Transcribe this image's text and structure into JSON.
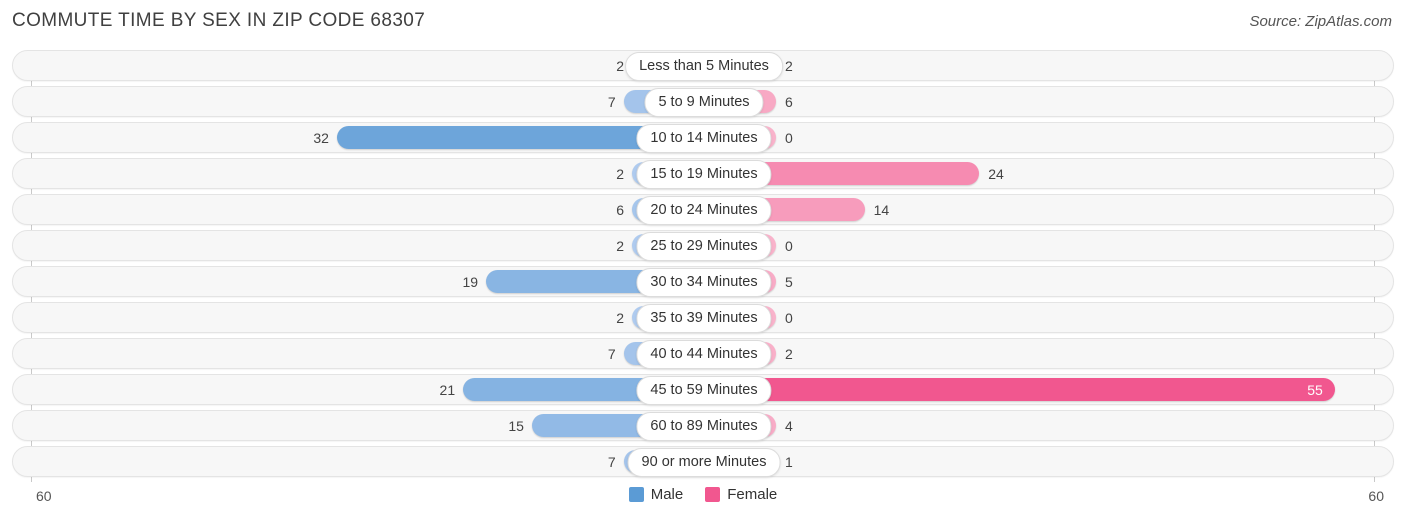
{
  "header": {
    "title": "COMMUTE TIME BY SEX IN ZIP CODE 68307",
    "source": "Source: ZipAtlas.com"
  },
  "legend": {
    "items": [
      {
        "label": "Male",
        "color": "#5b9bd5"
      },
      {
        "label": "Female",
        "color": "#f1578f"
      }
    ]
  },
  "axis": {
    "left_tick": "60",
    "right_tick": "60"
  },
  "chart_data": {
    "type": "bar",
    "orientation": "horizontal-diverging",
    "title": "COMMUTE TIME BY SEX IN ZIP CODE 68307",
    "xlabel": "",
    "ylabel": "",
    "xlim": [
      -60,
      60
    ],
    "axis_max": 60,
    "grid": false,
    "legend_position": "bottom-center",
    "categories": [
      "Less than 5 Minutes",
      "5 to 9 Minutes",
      "10 to 14 Minutes",
      "15 to 19 Minutes",
      "20 to 24 Minutes",
      "25 to 29 Minutes",
      "30 to 34 Minutes",
      "35 to 39 Minutes",
      "40 to 44 Minutes",
      "45 to 59 Minutes",
      "60 to 89 Minutes",
      "90 or more Minutes"
    ],
    "series": [
      {
        "name": "Male",
        "color": "#5b9bd5",
        "values": [
          2,
          7,
          32,
          2,
          6,
          2,
          19,
          2,
          7,
          21,
          15,
          7
        ],
        "labels": [
          "2",
          "7",
          "32",
          "2",
          "6",
          "2",
          "19",
          "2",
          "7",
          "21",
          "15",
          "7"
        ]
      },
      {
        "name": "Female",
        "color": "#f1578f",
        "values": [
          2,
          6,
          0,
          24,
          14,
          0,
          5,
          0,
          2,
          55,
          4,
          1
        ],
        "labels": [
          "2",
          "6",
          "0",
          "24",
          "14",
          "0",
          "5",
          "0",
          "2",
          "55",
          "4",
          "1"
        ]
      }
    ]
  }
}
